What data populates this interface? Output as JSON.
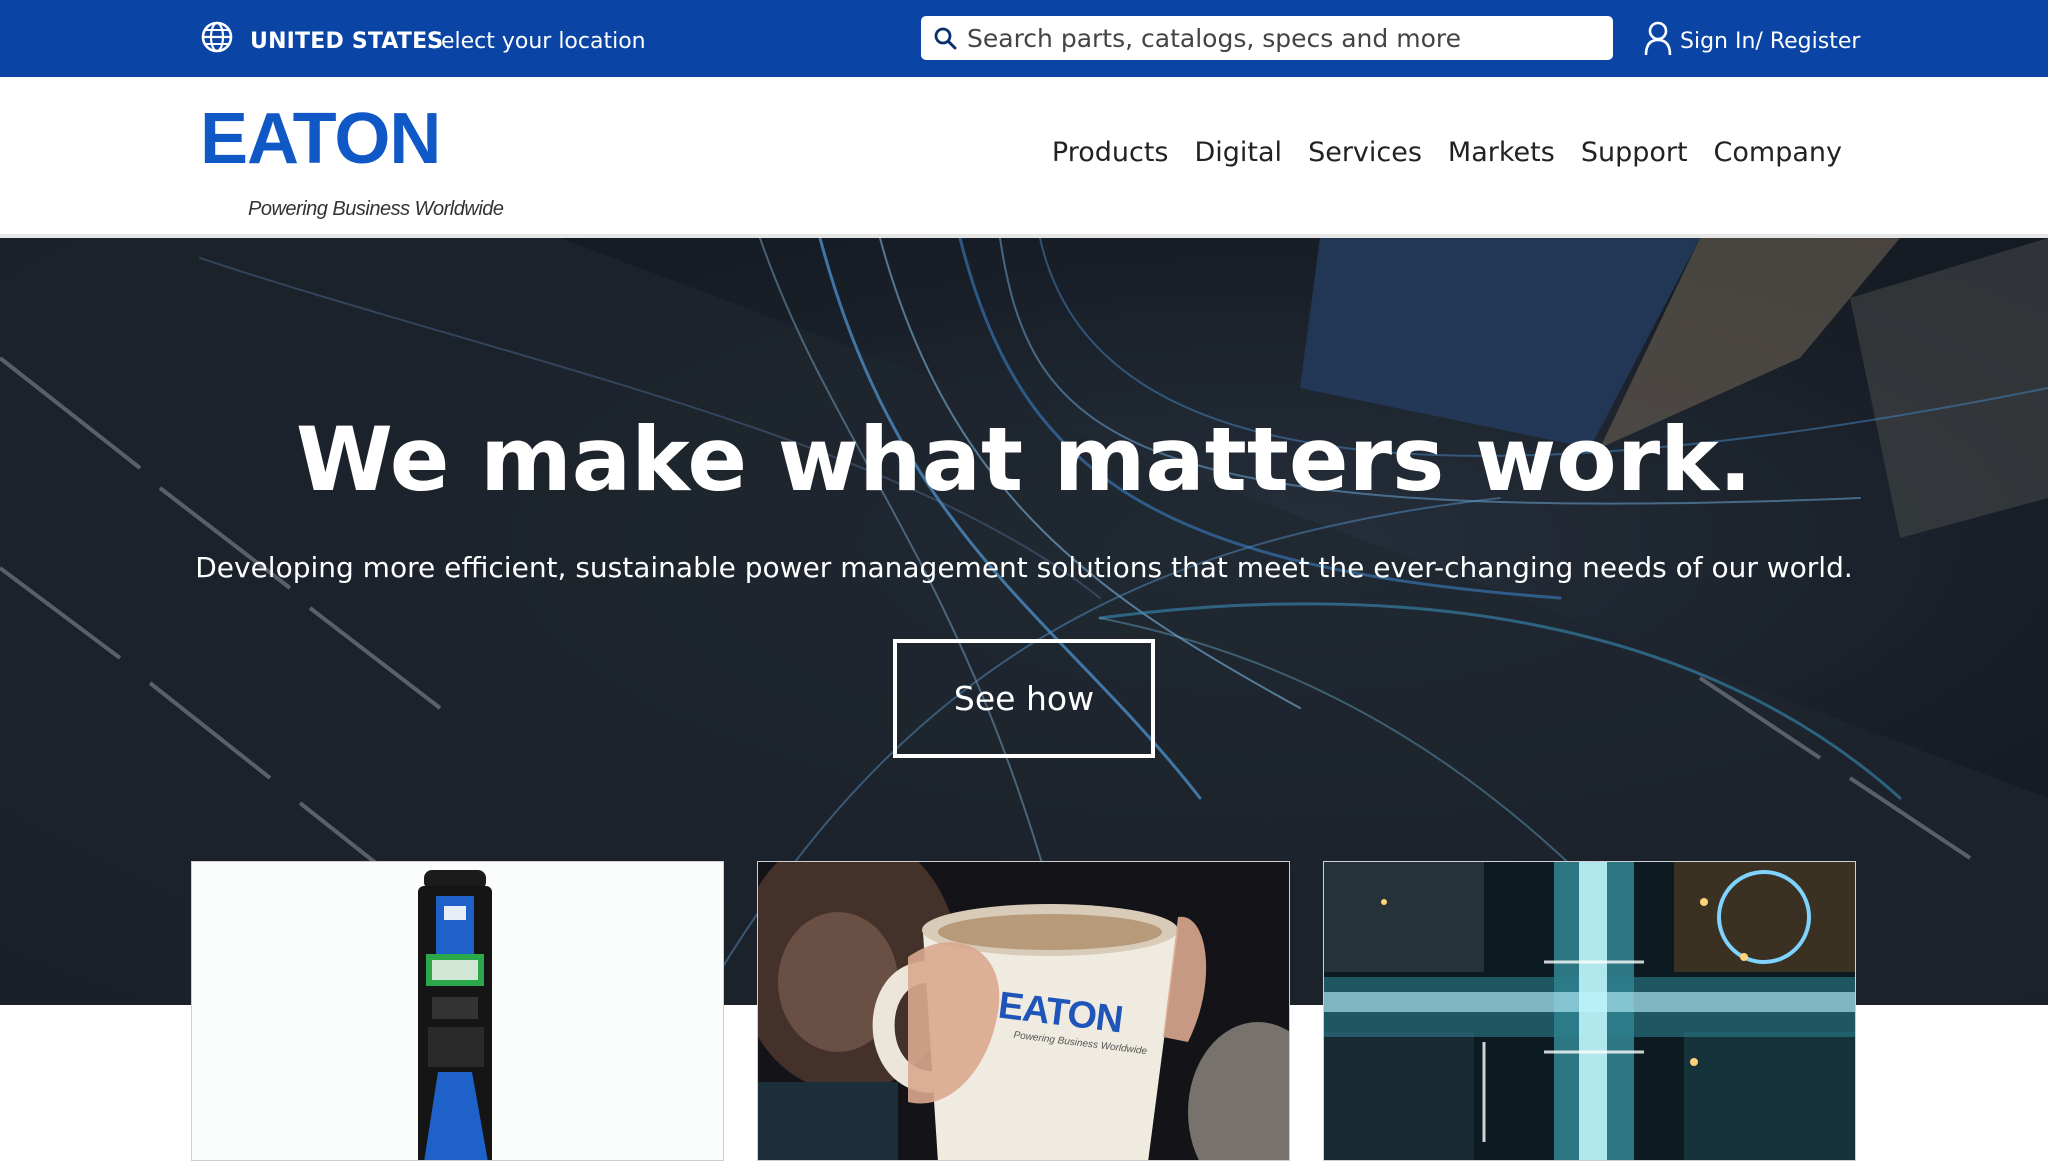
{
  "utility_bar": {
    "country": "UNITED STATES",
    "select_location": "Select your location",
    "search_placeholder": "Search parts, catalogs, specs and more",
    "sign_in": "Sign In/ Register",
    "icons": [
      "globe-icon",
      "search-icon",
      "user-icon"
    ]
  },
  "brand": {
    "logo_text": "EATON",
    "tagline": "Powering Business Worldwide"
  },
  "nav": {
    "items": [
      {
        "label": "Products"
      },
      {
        "label": "Digital"
      },
      {
        "label": "Services"
      },
      {
        "label": "Markets"
      },
      {
        "label": "Support"
      },
      {
        "label": "Company"
      }
    ]
  },
  "hero": {
    "title": "We make what matters work.",
    "subtitle": "Developing more efficient, sustainable power management solutions that meet the ever-changing needs of our world.",
    "cta": "See how"
  },
  "cards": {
    "mug_logo": "EATON",
    "mug_tagline": "Powering Business Worldwide"
  },
  "colors": {
    "utility_bar": "#0a45a6",
    "brand_blue": "#1158c7",
    "nav_text": "#222222",
    "hero_overlay": "#1c232d",
    "white": "#ffffff"
  }
}
